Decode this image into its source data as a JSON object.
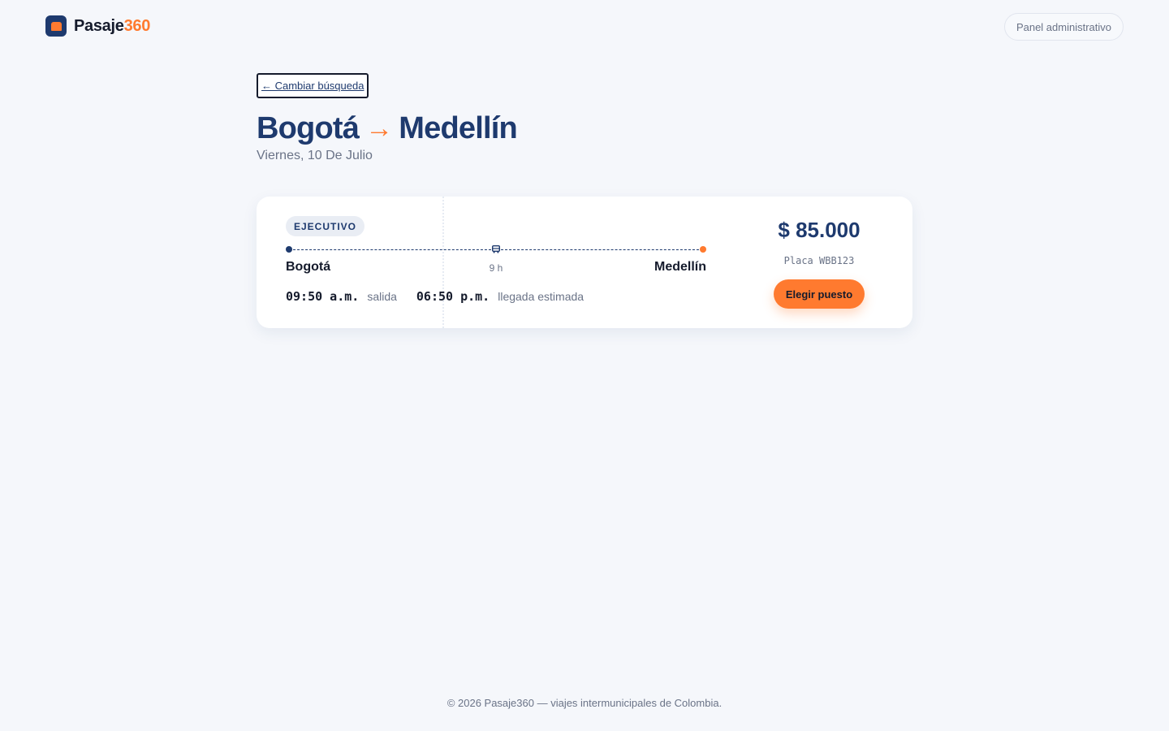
{
  "header": {
    "brand_main": "Pasaje",
    "brand_accent": "360",
    "admin_label": "Panel administrativo"
  },
  "search": {
    "back_label": "← Cambiar búsqueda",
    "origin": "Bogotá",
    "arrow": "→",
    "destination": "Medellín",
    "date": "Viernes, 10 De Julio"
  },
  "trip": {
    "class_label": "EJECUTIVO",
    "origin": "Bogotá",
    "destination": "Medellín",
    "duration": "9 h",
    "departure_time": "09:50 a.m.",
    "departure_label": "salida",
    "arrival_time": "06:50 p.m.",
    "arrival_label": "llegada estimada",
    "price": "$ 85.000",
    "plate": "Placa WBB123",
    "choose_label": "Elegir puesto"
  },
  "footer": {
    "text": "© 2026 Pasaje360 — viajes intermunicipales de Colombia."
  },
  "colors": {
    "primary": "#1e3a6e",
    "accent": "#ff7a2f",
    "background": "#f5f7fb"
  },
  "icons": {
    "logo": "bus-logo-icon",
    "timeline": "bus-icon"
  }
}
